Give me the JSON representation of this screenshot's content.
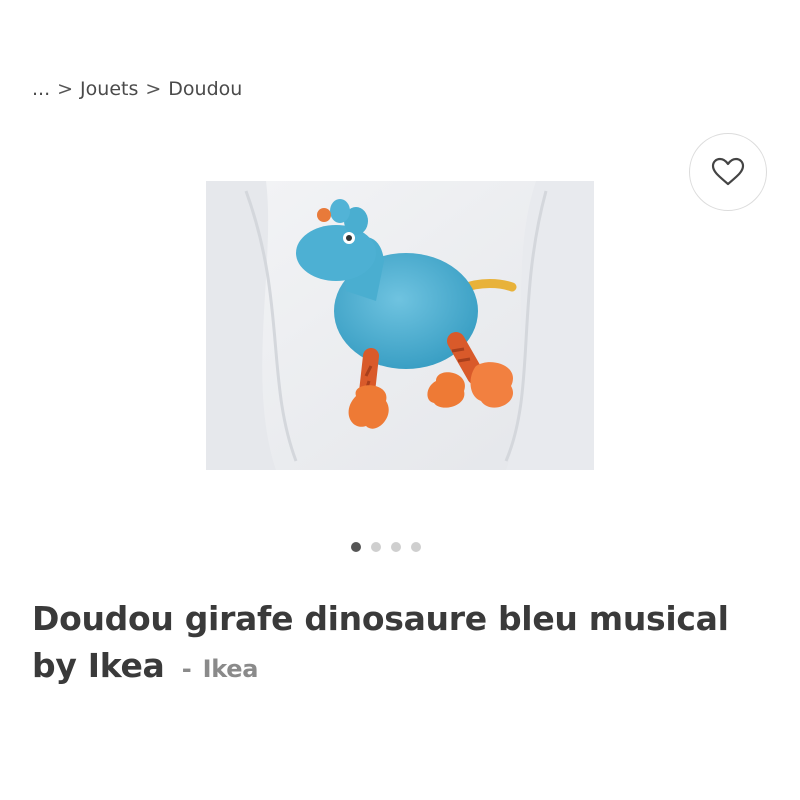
{
  "breadcrumb": {
    "ellipsis": "...",
    "separator": ">",
    "items": [
      "Jouets",
      "Doudou"
    ]
  },
  "favorite": {
    "icon": "heart-outline-icon"
  },
  "gallery": {
    "image_subject": "blue plush giraffe toy with orange feet",
    "dots": {
      "count": 4,
      "active_index": 0
    }
  },
  "product": {
    "title": "Doudou girafe dinosaure bleu musical by Ikea",
    "brand_separator": "-",
    "brand": "Ikea"
  },
  "colors": {
    "text": "#3a3a3a",
    "muted": "#8a8a8a",
    "dot_active": "#555555",
    "dot_inactive": "#cfcfcf"
  }
}
